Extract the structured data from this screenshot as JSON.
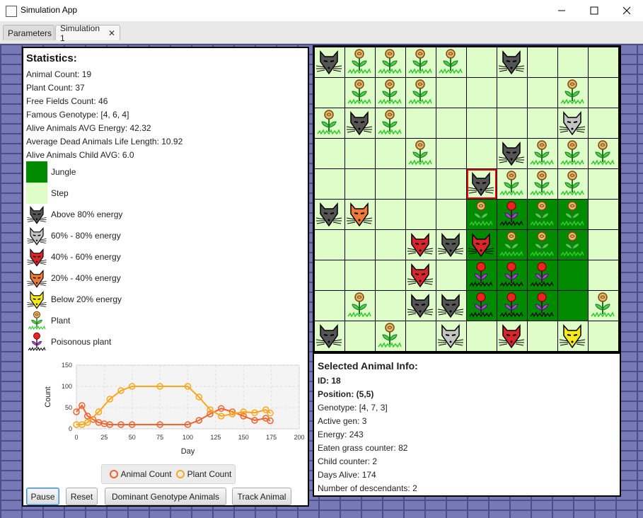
{
  "window": {
    "title": "Simulation App"
  },
  "tabs": [
    {
      "label": "Parameters",
      "active": false
    },
    {
      "label": "Simulation 1",
      "active": true,
      "close": "✕"
    }
  ],
  "stats": {
    "heading": "Statistics:",
    "lines": [
      "Animal Count: 19",
      "Plant Count: 37",
      "Free Fields Count: 46",
      "Famous Genotype: [4, 6, 4]",
      "Alive Animals AVG Energy: 42.32",
      "Average Dead Animals Life Length: 10.92",
      "Alive Animals Child AVG: 6.0"
    ],
    "legend": [
      {
        "icon": "jungle-swatch",
        "label": "Jungle"
      },
      {
        "icon": "step-swatch",
        "label": "Step"
      },
      {
        "icon": "animal-dark-gray-icon",
        "label": "Above 80% energy"
      },
      {
        "icon": "animal-light-gray-icon",
        "label": "60% - 80% energy"
      },
      {
        "icon": "animal-red-icon",
        "label": "40% - 60% energy"
      },
      {
        "icon": "animal-orange-icon",
        "label": "20% - 40% energy"
      },
      {
        "icon": "animal-yellow-icon",
        "label": "Below 20% energy"
      },
      {
        "icon": "plant-icon",
        "label": "Plant"
      },
      {
        "icon": "poisonous-plant-icon",
        "label": "Poisonous plant"
      }
    ]
  },
  "colors": {
    "jungle": "#008a00",
    "step": "#dffdc9",
    "animal_dark_gray": "#555555",
    "animal_light_gray": "#c4c4c4",
    "animal_red": "#d8262b",
    "animal_orange": "#ef7a38",
    "animal_yellow": "#f7ea1a",
    "series_animal": "#f3622d",
    "series_plant": "#fba71b",
    "selected_border": "#ee0000"
  },
  "chart_data": {
    "type": "line",
    "xlabel": "Day",
    "ylabel": "Count",
    "xlim": [
      0,
      200
    ],
    "ylim": [
      0,
      150
    ],
    "xticks": [
      0,
      25,
      50,
      75,
      100,
      125,
      150,
      175,
      200
    ],
    "yticks": [
      0,
      50,
      100,
      150
    ],
    "grid": true,
    "legend_position": "bottom",
    "series": [
      {
        "name": "Animal Count",
        "color": "#f3622d",
        "x": [
          0,
          5,
          10,
          15,
          20,
          25,
          30,
          40,
          50,
          75,
          100,
          110,
          120,
          130,
          140,
          150,
          160,
          170,
          174
        ],
        "y": [
          40,
          55,
          30,
          22,
          15,
          12,
          10,
          10,
          10,
          10,
          10,
          20,
          35,
          48,
          40,
          30,
          20,
          25,
          19
        ]
      },
      {
        "name": "Plant Count",
        "color": "#fba71b",
        "x": [
          0,
          5,
          10,
          20,
          30,
          40,
          50,
          75,
          100,
          110,
          120,
          130,
          140,
          150,
          160,
          170,
          174
        ],
        "y": [
          10,
          10,
          15,
          40,
          70,
          90,
          100,
          100,
          100,
          75,
          45,
          30,
          35,
          40,
          38,
          45,
          37
        ]
      }
    ]
  },
  "chart_legend": [
    "Animal Count",
    "Plant Count"
  ],
  "buttons": [
    "Pause",
    "Reset",
    "Dominant Genotype Animals",
    "Track Animal"
  ],
  "board": {
    "jungle": [
      [
        5,
        5
      ],
      [
        6,
        5
      ],
      [
        7,
        5
      ],
      [
        8,
        5
      ],
      [
        5,
        6
      ],
      [
        6,
        6
      ],
      [
        7,
        6
      ],
      [
        8,
        6
      ],
      [
        5,
        7
      ],
      [
        6,
        7
      ],
      [
        7,
        7
      ],
      [
        8,
        7
      ],
      [
        5,
        8
      ],
      [
        6,
        8
      ],
      [
        7,
        8
      ],
      [
        8,
        8
      ]
    ],
    "plants": [
      [
        1,
        0
      ],
      [
        2,
        0
      ],
      [
        3,
        0
      ],
      [
        4,
        0
      ],
      [
        1,
        1
      ],
      [
        2,
        1
      ],
      [
        3,
        1
      ],
      [
        8,
        1
      ],
      [
        0,
        2
      ],
      [
        2,
        2
      ],
      [
        6,
        3
      ],
      [
        7,
        3
      ],
      [
        8,
        3
      ],
      [
        9,
        3
      ],
      [
        3,
        3
      ],
      [
        6,
        4
      ],
      [
        7,
        4
      ],
      [
        8,
        4
      ],
      [
        5,
        5
      ],
      [
        7,
        5
      ],
      [
        8,
        5
      ],
      [
        6,
        6
      ],
      [
        7,
        6
      ],
      [
        8,
        6
      ],
      [
        1,
        8
      ],
      [
        9,
        8
      ],
      [
        2,
        9
      ]
    ],
    "poisonous": [
      [
        6,
        5
      ],
      [
        5,
        7
      ],
      [
        6,
        7
      ],
      [
        7,
        7
      ],
      [
        5,
        8
      ],
      [
        6,
        8
      ],
      [
        7,
        8
      ]
    ],
    "animals": [
      {
        "pos": [
          0,
          0
        ],
        "tone": "animal_dark_gray"
      },
      {
        "pos": [
          6,
          0
        ],
        "tone": "animal_dark_gray"
      },
      {
        "pos": [
          1,
          2
        ],
        "tone": "animal_dark_gray"
      },
      {
        "pos": [
          8,
          2
        ],
        "tone": "animal_light_gray"
      },
      {
        "pos": [
          6,
          3
        ],
        "tone": "animal_dark_gray"
      },
      {
        "pos": [
          5,
          4
        ],
        "tone": "animal_dark_gray"
      },
      {
        "pos": [
          0,
          5
        ],
        "tone": "animal_dark_gray"
      },
      {
        "pos": [
          1,
          5
        ],
        "tone": "animal_orange"
      },
      {
        "pos": [
          3,
          6
        ],
        "tone": "animal_red"
      },
      {
        "pos": [
          4,
          6
        ],
        "tone": "animal_dark_gray"
      },
      {
        "pos": [
          5,
          6
        ],
        "tone": "animal_red"
      },
      {
        "pos": [
          3,
          7
        ],
        "tone": "animal_red"
      },
      {
        "pos": [
          3,
          8
        ],
        "tone": "animal_dark_gray"
      },
      {
        "pos": [
          4,
          8
        ],
        "tone": "animal_dark_gray"
      },
      {
        "pos": [
          0,
          9
        ],
        "tone": "animal_dark_gray"
      },
      {
        "pos": [
          4,
          9
        ],
        "tone": "animal_light_gray"
      },
      {
        "pos": [
          6,
          9
        ],
        "tone": "animal_red"
      },
      {
        "pos": [
          8,
          9
        ],
        "tone": "animal_yellow"
      }
    ],
    "selected": [
      5,
      4
    ]
  },
  "selected_animal": {
    "heading": "Selected Animal Info:",
    "id": "ID: 18",
    "position": "Position: (5,5)",
    "lines": [
      "Genotype: [4, 7, 3]",
      "Active gen: 3",
      "Energy: 243",
      "Eaten grass counter: 82",
      "Child counter: 2",
      "Days Alive: 174",
      "Number of descendants: 2"
    ]
  }
}
